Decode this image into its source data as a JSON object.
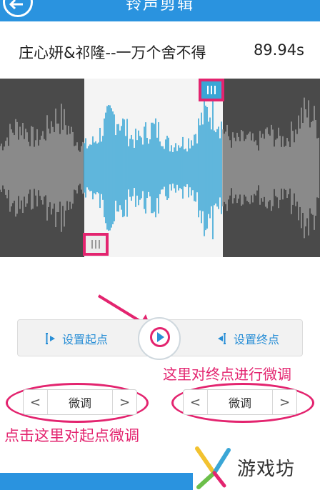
{
  "header": {
    "title": "铃声剪辑"
  },
  "song": {
    "title": "庄心妍&祁隆--一万个舍不得",
    "duration": "89.94s"
  },
  "controls": {
    "set_start_label": "设置起点",
    "set_end_label": "设置终点"
  },
  "fine_tune": {
    "left_label": "微调",
    "right_label": "微调"
  },
  "annotations": {
    "end_note": "这里对终点进行微调",
    "start_note": "点击这里对起点微调"
  },
  "watermark": {
    "text": "游戏坊"
  },
  "colors": {
    "accent": "#2a93df",
    "highlight": "#e3246f",
    "wave_selected": "#3aa6d6",
    "wave_unselected": "#9a9a9a",
    "wave_bg": "#4a4a4a"
  }
}
